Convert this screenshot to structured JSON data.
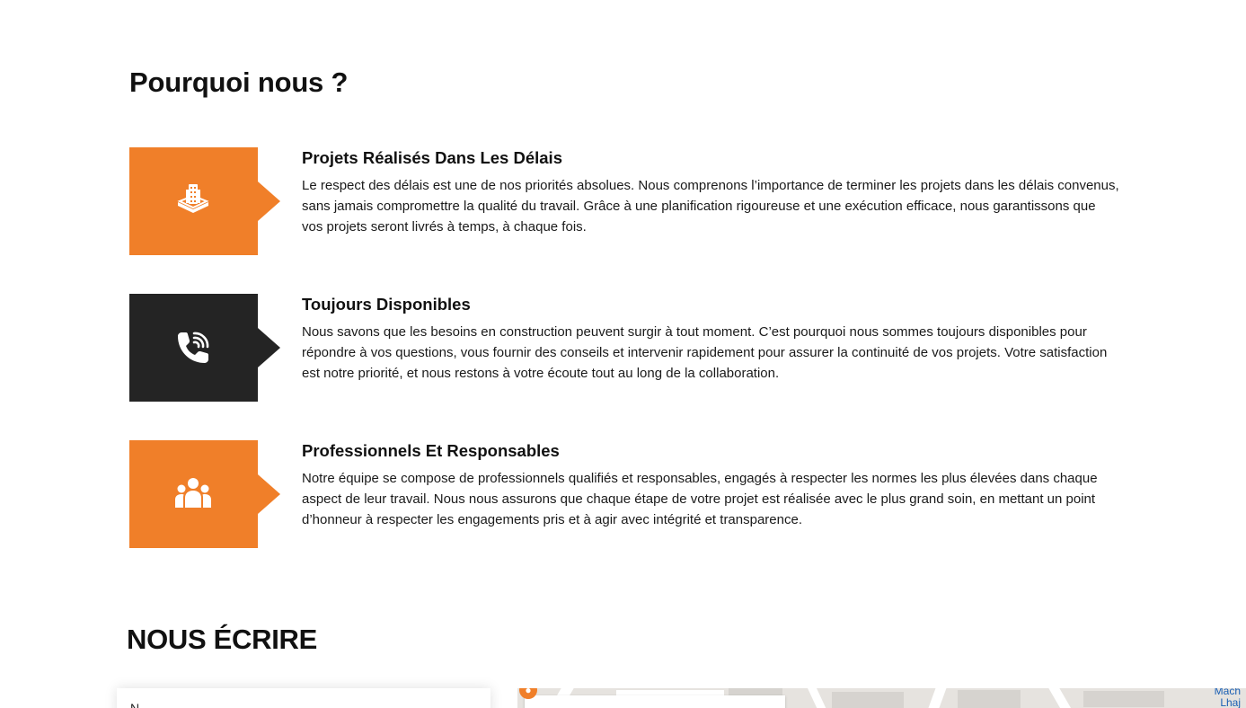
{
  "why_us": {
    "title": "Pourquoi nous ?",
    "features": [
      {
        "icon": "building-icon",
        "color": "#f07f29",
        "title": "Projets Réalisés Dans Les Délais",
        "description": "Le respect des délais est une de nos priorités absolues. Nous comprenons l’importance de terminer les projets dans les délais convenus, sans jamais compromettre la qualité du travail. Grâce à une planification rigoureuse et une exécution efficace, nous garantissons que vos projets seront livrés à temps, à chaque fois."
      },
      {
        "icon": "phone-icon",
        "color": "#242424",
        "title": "Toujours Disponibles",
        "description": "Nous savons que les besoins en construction peuvent surgir à tout moment. C’est pourquoi nous sommes toujours disponibles pour répondre à vos questions, vous fournir des conseils et intervenir rapidement pour assurer la continuité de vos projets. Votre satisfaction est notre priorité, et nous restons à votre écoute tout au long de la collaboration."
      },
      {
        "icon": "team-icon",
        "color": "#f07f29",
        "title": "Professionnels Et Responsables",
        "description": "Notre équipe se compose de professionnels qualifiés et responsables, engagés à respecter les normes les plus élevées dans chaque aspect de leur travail. Nous nous assurons que chaque étape de votre projet est réalisée avec le plus grand soin, en mettant un point d’honneur à respecter les engagements pris et à agir avec intégrité et transparence."
      }
    ]
  },
  "contact": {
    "title": "NOUS ÉCRIRE",
    "form": {
      "first_field_label": "N"
    },
    "map": {
      "place_label": "Mach Lhaj"
    }
  }
}
